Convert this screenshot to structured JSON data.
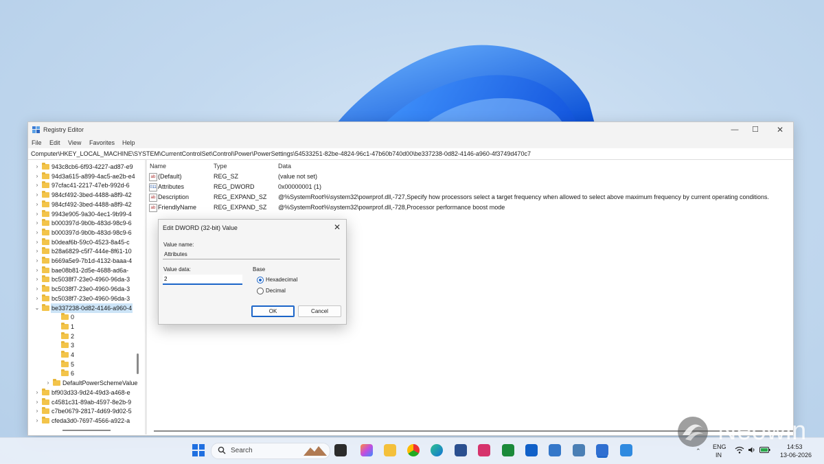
{
  "window": {
    "title": "Registry Editor",
    "controls": {
      "minimize": "—",
      "maximize": "☐",
      "close": "✕"
    },
    "menu": [
      "File",
      "Edit",
      "View",
      "Favorites",
      "Help"
    ],
    "address": "Computer\\HKEY_LOCAL_MACHINE\\SYSTEM\\CurrentControlSet\\Control\\Power\\PowerSettings\\54533251-82be-4824-96c1-47b60b740d00\\be337238-0d82-4146-a960-4f3749d470c7"
  },
  "tree": {
    "items": [
      "943c8cb6-6f93-4227-ad87-e9",
      "94d3a615-a899-4ac5-ae2b-e4",
      "97cfac41-2217-47eb-992d-6",
      "984cf492-3bed-4488-a8f9-42",
      "984cf492-3bed-4488-a8f9-42",
      "9943e905-9a30-4ec1-9b99-4",
      "b000397d-9b0b-483d-98c9-6",
      "b000397d-9b0b-483d-98c9-6",
      "b0deaf6b-59c0-4523-8a45-c",
      "b28a6829-c5f7-444e-8f61-10",
      "b669a5e9-7b1d-4132-baaa-4",
      "bae08b81-2d5e-4688-ad6a-",
      "bc5038f7-23e0-4960-96da-3",
      "bc5038f7-23e0-4960-96da-3",
      "bc5038f7-23e0-4960-96da-3",
      "be337238-0d82-4146-a960-4",
      "0",
      "1",
      "2",
      "3",
      "4",
      "5",
      "6",
      "DefaultPowerSchemeValue",
      "bf903d33-9d24-49d3-a468-e",
      "c4581c31-89ab-4597-8e2b-9",
      "c7be0679-2817-4d69-9d02-5",
      "cfeda3d0-7697-4566-a922-a"
    ]
  },
  "list": {
    "headers": {
      "name": "Name",
      "type": "Type",
      "data": "Data"
    },
    "rows": [
      {
        "icon": "ab",
        "name": "(Default)",
        "type": "REG_SZ",
        "data": "(value not set)"
      },
      {
        "icon": "011",
        "name": "Attributes",
        "type": "REG_DWORD",
        "data": "0x00000001 (1)"
      },
      {
        "icon": "ab",
        "name": "Description",
        "type": "REG_EXPAND_SZ",
        "data": "@%SystemRoot%\\system32\\powrprof.dll,-727,Specify how processors select a target frequency when allowed to select above maximum frequency by current operating conditions."
      },
      {
        "icon": "ab",
        "name": "FriendlyName",
        "type": "REG_EXPAND_SZ",
        "data": "@%SystemRoot%\\system32\\powrprof.dll,-728,Processor performance boost mode"
      }
    ]
  },
  "dialog": {
    "title": "Edit DWORD (32-bit) Value",
    "close": "✕",
    "value_name_label": "Value name:",
    "value_name": "Attributes",
    "value_data_label": "Value data:",
    "value_data": "2",
    "base_label": "Base",
    "hex_label": "Hexadecimal",
    "dec_label": "Decimal",
    "ok": "OK",
    "cancel": "Cancel"
  },
  "taskbar": {
    "search_placeholder": "Search",
    "lang_top": "ENG",
    "lang_bottom": "IN",
    "time": "14:53",
    "date": "13-06-2026"
  },
  "watermark": "Neowin"
}
